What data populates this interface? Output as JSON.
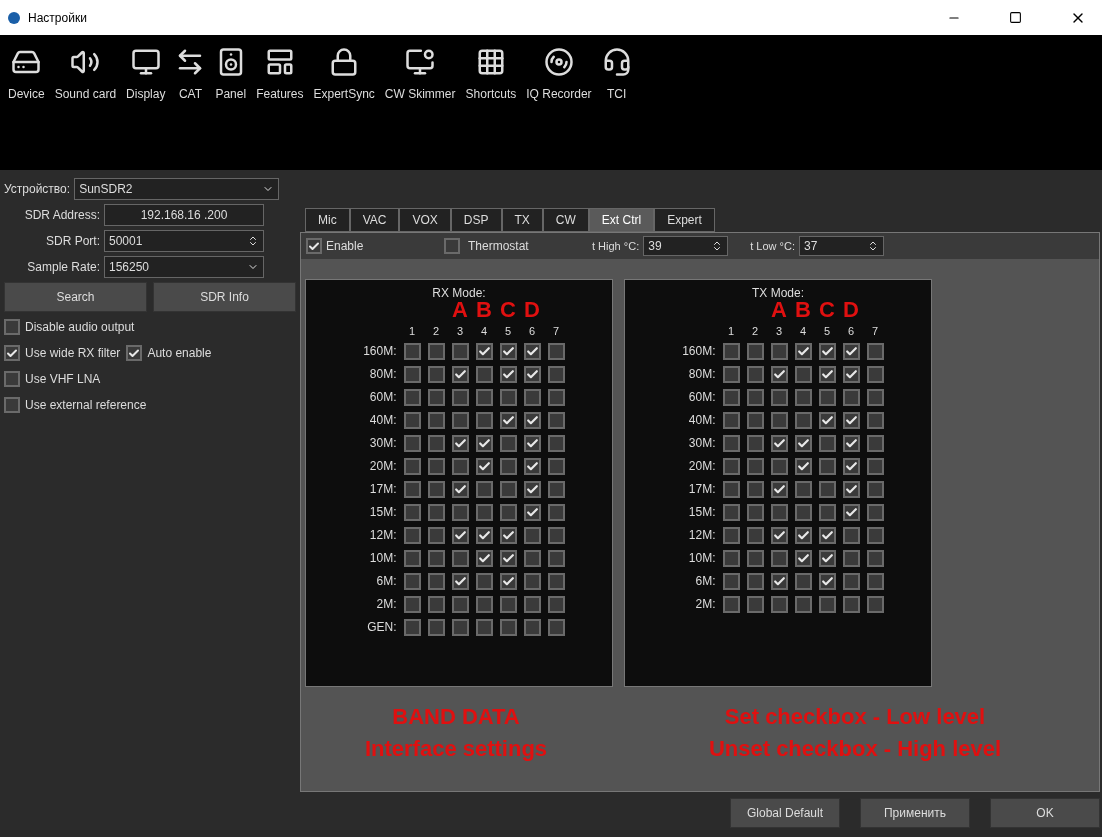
{
  "window": {
    "title": "Настройки"
  },
  "toolbar": [
    {
      "label": "Device",
      "kind": "device"
    },
    {
      "label": "Sound card",
      "kind": "sound"
    },
    {
      "label": "Display",
      "kind": "display"
    },
    {
      "label": "CAT",
      "kind": "cat"
    },
    {
      "label": "Panel",
      "kind": "panel"
    },
    {
      "label": "Features",
      "kind": "features"
    },
    {
      "label": "ExpertSync",
      "kind": "sync"
    },
    {
      "label": "CW Skimmer",
      "kind": "skimmer"
    },
    {
      "label": "Shortcuts",
      "kind": "shortcuts"
    },
    {
      "label": "IQ Recorder",
      "kind": "recorder"
    },
    {
      "label": "TCI",
      "kind": "tci"
    }
  ],
  "device": {
    "label": "Устройство:",
    "value": "SunSDR2"
  },
  "fields": [
    {
      "label": "SDR Address:",
      "value": "192.168.16 .200",
      "kind": "text"
    },
    {
      "label": "SDR Port:",
      "value": "50001",
      "kind": "spin"
    },
    {
      "label": "Sample Rate:",
      "value": "156250",
      "kind": "combo"
    }
  ],
  "buttons": [
    "Search",
    "SDR Info"
  ],
  "options": [
    {
      "items": [
        {
          "label": "Disable audio output",
          "checked": false
        }
      ]
    },
    {
      "items": [
        {
          "label": "Use wide RX filter",
          "checked": true
        },
        {
          "label": "Auto enable",
          "checked": true
        }
      ]
    },
    {
      "items": [
        {
          "label": "Use VHF LNA",
          "checked": false
        }
      ]
    },
    {
      "items": [
        {
          "label": "Use external reference",
          "checked": false
        }
      ]
    }
  ],
  "tabs": [
    {
      "label": "Mic",
      "selected": false
    },
    {
      "label": "VAC",
      "selected": false
    },
    {
      "label": "VOX",
      "selected": false
    },
    {
      "label": "DSP",
      "selected": false
    },
    {
      "label": "TX",
      "selected": false
    },
    {
      "label": "CW",
      "selected": false
    },
    {
      "label": "Ext Ctrl",
      "selected": true
    },
    {
      "label": "Expert",
      "selected": false
    }
  ],
  "ext": {
    "enable": {
      "label": "Enable",
      "checked": true
    },
    "thermostat": {
      "label": "Thermostat",
      "checked": false
    },
    "t_high": {
      "label": "t High °C:",
      "value": "39"
    },
    "t_low": {
      "label": "t Low °C:",
      "value": "37"
    }
  },
  "grids": [
    {
      "title": "RX Mode:",
      "letters": [
        "A",
        "B",
        "C",
        "D"
      ],
      "columns": [
        "1",
        "2",
        "3",
        "4",
        "5",
        "6",
        "7"
      ],
      "rows": [
        {
          "label": "160M:",
          "checks": [
            false,
            false,
            false,
            true,
            true,
            true,
            false
          ]
        },
        {
          "label": "80M:",
          "checks": [
            false,
            false,
            true,
            false,
            true,
            true,
            false
          ]
        },
        {
          "label": "60M:",
          "checks": [
            false,
            false,
            false,
            false,
            false,
            false,
            false
          ]
        },
        {
          "label": "40M:",
          "checks": [
            false,
            false,
            false,
            false,
            true,
            true,
            false
          ]
        },
        {
          "label": "30M:",
          "checks": [
            false,
            false,
            true,
            true,
            false,
            true,
            false
          ]
        },
        {
          "label": "20M:",
          "checks": [
            false,
            false,
            false,
            true,
            false,
            true,
            false
          ]
        },
        {
          "label": "17M:",
          "checks": [
            false,
            false,
            true,
            false,
            false,
            true,
            false
          ]
        },
        {
          "label": "15M:",
          "checks": [
            false,
            false,
            false,
            false,
            false,
            true,
            false
          ]
        },
        {
          "label": "12M:",
          "checks": [
            false,
            false,
            true,
            true,
            true,
            false,
            false
          ]
        },
        {
          "label": "10M:",
          "checks": [
            false,
            false,
            false,
            true,
            true,
            false,
            false
          ]
        },
        {
          "label": "6M:",
          "checks": [
            false,
            false,
            true,
            false,
            true,
            false,
            false
          ]
        },
        {
          "label": "2M:",
          "checks": [
            false,
            false,
            false,
            false,
            false,
            false,
            false
          ]
        },
        {
          "label": "GEN:",
          "checks": [
            false,
            false,
            false,
            false,
            false,
            false,
            false
          ]
        }
      ]
    },
    {
      "title": "TX Mode:",
      "letters": [
        "A",
        "B",
        "C",
        "D"
      ],
      "columns": [
        "1",
        "2",
        "3",
        "4",
        "5",
        "6",
        "7"
      ],
      "rows": [
        {
          "label": "160M:",
          "checks": [
            false,
            false,
            false,
            true,
            true,
            true,
            false
          ]
        },
        {
          "label": "80M:",
          "checks": [
            false,
            false,
            true,
            false,
            true,
            true,
            false
          ]
        },
        {
          "label": "60M:",
          "checks": [
            false,
            false,
            false,
            false,
            false,
            false,
            false
          ]
        },
        {
          "label": "40M:",
          "checks": [
            false,
            false,
            false,
            false,
            true,
            true,
            false
          ]
        },
        {
          "label": "30M:",
          "checks": [
            false,
            false,
            true,
            true,
            false,
            true,
            false
          ]
        },
        {
          "label": "20M:",
          "checks": [
            false,
            false,
            false,
            true,
            false,
            true,
            false
          ]
        },
        {
          "label": "17M:",
          "checks": [
            false,
            false,
            true,
            false,
            false,
            true,
            false
          ]
        },
        {
          "label": "15M:",
          "checks": [
            false,
            false,
            false,
            false,
            false,
            true,
            false
          ]
        },
        {
          "label": "12M:",
          "checks": [
            false,
            false,
            true,
            true,
            true,
            false,
            false
          ]
        },
        {
          "label": "10M:",
          "checks": [
            false,
            false,
            false,
            true,
            true,
            false,
            false
          ]
        },
        {
          "label": "6M:",
          "checks": [
            false,
            false,
            true,
            false,
            true,
            false,
            false
          ]
        },
        {
          "label": "2M:",
          "checks": [
            false,
            false,
            false,
            false,
            false,
            false,
            false
          ]
        }
      ]
    }
  ],
  "notes": [
    [
      "BAND DATA",
      "Interface settings"
    ],
    [
      "Set checkbox - Low level",
      "Unset checkbox - High level"
    ]
  ],
  "footer": [
    "Global Default",
    "Применить",
    "OK"
  ]
}
